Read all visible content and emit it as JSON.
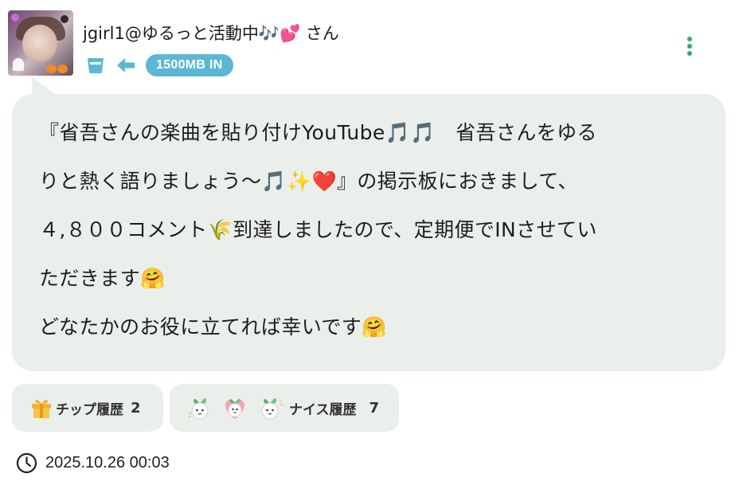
{
  "header": {
    "username": "jgirl1@ゆるっと活動中🎶💕 さん",
    "badge_text": "1500MB IN",
    "icons": {
      "cup": "cup-icon",
      "arrow": "arrow-left-icon",
      "more": "more-vertical-icon"
    },
    "colors": {
      "badge": "#5bb8d2",
      "cup": "#5bb8d2",
      "more": "#3aa86a"
    }
  },
  "post": {
    "lines": [
      "『省吾さんの楽曲を貼り付けYouTube🎵🎵　省吾さんをゆる",
      "りと熱く語りましょう〜🎵✨❤️』の掲示板におきまして、",
      "４,８００コメント🌾到達しましたので、定期便でINさせてい",
      "ただきます🤗",
      "どなたかのお役に立てれば幸いです🤗"
    ],
    "bubble_color": "#eaefec"
  },
  "reactions": {
    "tip": {
      "label": "チップ履歴",
      "count": "2",
      "icon": "gift-icon"
    },
    "nice": {
      "label": "ナイス履歴",
      "count": "7",
      "stickers": [
        "turnip-sticker-icon",
        "turnip-heart-sticker-icon",
        "turnip-sticker-icon"
      ]
    }
  },
  "footer": {
    "timestamp": "2025.10.26 00:03",
    "icon": "clock-icon"
  }
}
